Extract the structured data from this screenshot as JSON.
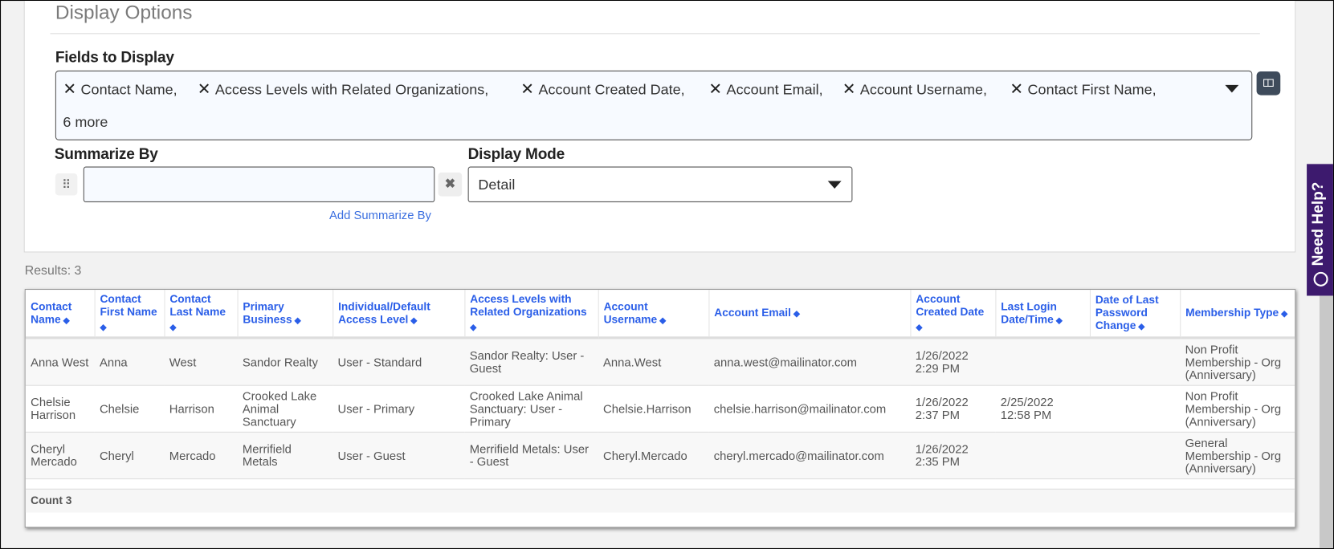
{
  "display_options": {
    "title": "Display Options",
    "fields_label": "Fields to Display",
    "fields": [
      "Contact Name,",
      "Access Levels with Related Organizations,",
      "Account Created Date,",
      "Account Email,",
      "Account Username,",
      "Contact First Name,"
    ],
    "more": "6 more",
    "summarize_label": "Summarize By",
    "summarize_value": "",
    "add_summarize": "Add Summarize By",
    "display_mode_label": "Display Mode",
    "display_mode_value": "Detail"
  },
  "results": {
    "label": "Results: 3",
    "columns": [
      "Contact Name",
      "Contact First Name",
      "Contact Last Name",
      "Primary Business",
      "Individual/Default Access Level",
      "Access Levels with Related Organizations",
      "Account Username",
      "Account Email",
      "Account Created Date",
      "Last Login Date/Time",
      "Date of Last Password Change",
      "Membership Type"
    ],
    "rows": [
      [
        "Anna West",
        "Anna",
        "West",
        "Sandor Realty",
        "User - Standard",
        "Sandor Realty: User - Guest",
        "Anna.West",
        "anna.west@mailinator.com",
        "1/26/2022 2:29 PM",
        "",
        "",
        "Non Profit Membership - Org (Anniversary)"
      ],
      [
        "Chelsie Harrison",
        "Chelsie",
        "Harrison",
        "Crooked Lake Animal Sanctuary",
        "User - Primary",
        "Crooked Lake Animal Sanctuary: User - Primary",
        "Chelsie.Harrison",
        "chelsie.harrison@mailinator.com",
        "1/26/2022 2:37 PM",
        "2/25/2022 12:58 PM",
        "",
        "Non Profit Membership - Org (Anniversary)"
      ],
      [
        "Cheryl Mercado",
        "Cheryl",
        "Mercado",
        "Merrifield Metals",
        "User - Guest",
        "Merrifield Metals: User - Guest",
        "Cheryl.Mercado",
        "cheryl.mercado@mailinator.com",
        "1/26/2022 2:35 PM",
        "",
        "",
        "General Membership - Org (Anniversary)"
      ]
    ],
    "count": "Count 3"
  },
  "help": {
    "label": "Need Help?"
  },
  "colors": {
    "header_link": "#2a5ee8",
    "help_tab": "#3d1a6e",
    "grid_button": "#3e4b5b"
  }
}
